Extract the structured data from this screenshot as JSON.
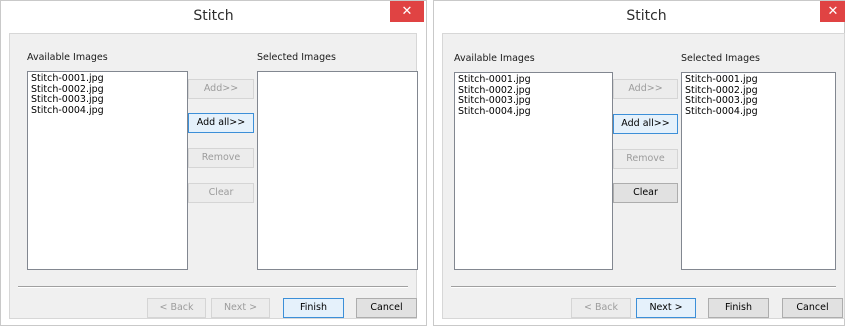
{
  "left_dialog": {
    "title": "Stitch",
    "close_glyph": "✕",
    "available_label": "Available Images",
    "selected_label": "Selected Images",
    "available_items": [
      "Stitch-0001.jpg",
      "Stitch-0002.jpg",
      "Stitch-0003.jpg",
      "Stitch-0004.jpg"
    ],
    "selected_items": [],
    "buttons": {
      "add": "Add>>",
      "add_all": "Add all>>",
      "remove": "Remove",
      "clear": "Clear",
      "back": "< Back",
      "next": "Next >",
      "finish": "Finish",
      "cancel": "Cancel"
    }
  },
  "right_dialog": {
    "title": "Stitch",
    "close_glyph": "✕",
    "available_label": "Available Images",
    "selected_label": "Selected Images",
    "available_items": [
      "Stitch-0001.jpg",
      "Stitch-0002.jpg",
      "Stitch-0003.jpg",
      "Stitch-0004.jpg"
    ],
    "selected_items": [
      "Stitch-0001.jpg",
      "Stitch-0002.jpg",
      "Stitch-0003.jpg",
      "Stitch-0004.jpg"
    ],
    "buttons": {
      "add": "Add>>",
      "add_all": "Add all>>",
      "remove": "Remove",
      "clear": "Clear",
      "back": "< Back",
      "next": "Next >",
      "finish": "Finish",
      "cancel": "Cancel"
    }
  },
  "colors": {
    "close_button": "#e04343",
    "focus_border": "#3c8fd8",
    "dialog_background": "#f0f0f0"
  }
}
